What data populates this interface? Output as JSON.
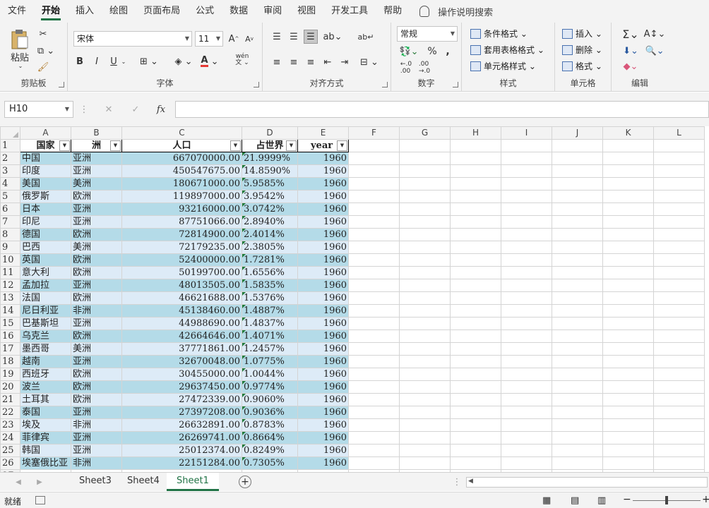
{
  "ribbon_tabs": [
    "文件",
    "开始",
    "插入",
    "绘图",
    "页面布局",
    "公式",
    "数据",
    "审阅",
    "视图",
    "开发工具",
    "帮助"
  ],
  "active_tab": "开始",
  "tell_me": "操作说明搜索",
  "clipboard": {
    "paste": "粘贴",
    "label": "剪贴板"
  },
  "font": {
    "name": "宋体",
    "size": "11",
    "label": "字体",
    "bold": "B",
    "italic": "I",
    "underline": "U",
    "font_color": "#e53935",
    "phonetic": "wén"
  },
  "alignment": {
    "label": "对齐方式"
  },
  "number": {
    "format": "常规",
    "label": "数字",
    "percent": "%",
    "comma": ","
  },
  "styles": {
    "conditional": "条件格式",
    "table": "套用表格格式",
    "cell": "单元格样式",
    "label": "样式"
  },
  "cells": {
    "insert": "插入",
    "delete": "删除",
    "format": "格式",
    "label": "单元格"
  },
  "editing": {
    "label": "编辑"
  },
  "formula_bar": {
    "name_box": "H10",
    "fx": "fx",
    "value": ""
  },
  "columns": [
    "A",
    "B",
    "C",
    "D",
    "E",
    "F",
    "G",
    "H",
    "I",
    "J",
    "K",
    "L"
  ],
  "header_row": {
    "num": "1",
    "cells": [
      "国家",
      "洲",
      "人口",
      "占世界",
      "year"
    ]
  },
  "rows": [
    {
      "num": "2",
      "c": [
        "中国",
        "亚洲",
        "667070000.00",
        "21.9999%",
        "1960"
      ]
    },
    {
      "num": "3",
      "c": [
        "印度",
        "亚洲",
        "450547675.00",
        "14.8590%",
        "1960"
      ]
    },
    {
      "num": "4",
      "c": [
        "美国",
        "美洲",
        "180671000.00",
        "5.9585%",
        "1960"
      ]
    },
    {
      "num": "5",
      "c": [
        "俄罗斯",
        "欧洲",
        "119897000.00",
        "3.9542%",
        "1960"
      ]
    },
    {
      "num": "6",
      "c": [
        "日本",
        "亚洲",
        "93216000.00",
        "3.0742%",
        "1960"
      ]
    },
    {
      "num": "7",
      "c": [
        "印尼",
        "亚洲",
        "87751066.00",
        "2.8940%",
        "1960"
      ]
    },
    {
      "num": "8",
      "c": [
        "德国",
        "欧洲",
        "72814900.00",
        "2.4014%",
        "1960"
      ]
    },
    {
      "num": "9",
      "c": [
        "巴西",
        "美洲",
        "72179235.00",
        "2.3805%",
        "1960"
      ]
    },
    {
      "num": "10",
      "c": [
        "英国",
        "欧洲",
        "52400000.00",
        "1.7281%",
        "1960"
      ]
    },
    {
      "num": "11",
      "c": [
        "意大利",
        "欧洲",
        "50199700.00",
        "1.6556%",
        "1960"
      ]
    },
    {
      "num": "12",
      "c": [
        "孟加拉",
        "亚洲",
        "48013505.00",
        "1.5835%",
        "1960"
      ]
    },
    {
      "num": "13",
      "c": [
        "法国",
        "欧洲",
        "46621688.00",
        "1.5376%",
        "1960"
      ]
    },
    {
      "num": "14",
      "c": [
        "尼日利亚",
        "非洲",
        "45138460.00",
        "1.4887%",
        "1960"
      ]
    },
    {
      "num": "15",
      "c": [
        "巴基斯坦",
        "亚洲",
        "44988690.00",
        "1.4837%",
        "1960"
      ]
    },
    {
      "num": "16",
      "c": [
        "乌克兰",
        "欧洲",
        "42664646.00",
        "1.4071%",
        "1960"
      ]
    },
    {
      "num": "17",
      "c": [
        "墨西哥",
        "美洲",
        "37771861.00",
        "1.2457%",
        "1960"
      ]
    },
    {
      "num": "18",
      "c": [
        "越南",
        "亚洲",
        "32670048.00",
        "1.0775%",
        "1960"
      ]
    },
    {
      "num": "19",
      "c": [
        "西班牙",
        "欧洲",
        "30455000.00",
        "1.0044%",
        "1960"
      ]
    },
    {
      "num": "20",
      "c": [
        "波兰",
        "欧洲",
        "29637450.00",
        "0.9774%",
        "1960"
      ]
    },
    {
      "num": "21",
      "c": [
        "土耳其",
        "欧洲",
        "27472339.00",
        "0.9060%",
        "1960"
      ]
    },
    {
      "num": "22",
      "c": [
        "泰国",
        "亚洲",
        "27397208.00",
        "0.9036%",
        "1960"
      ]
    },
    {
      "num": "23",
      "c": [
        "埃及",
        "非洲",
        "26632891.00",
        "0.8783%",
        "1960"
      ]
    },
    {
      "num": "24",
      "c": [
        "菲律宾",
        "亚洲",
        "26269741.00",
        "0.8664%",
        "1960"
      ]
    },
    {
      "num": "25",
      "c": [
        "韩国",
        "亚洲",
        "25012374.00",
        "0.8249%",
        "1960"
      ]
    },
    {
      "num": "26",
      "c": [
        "埃塞俄比亚",
        "非洲",
        "22151284.00",
        "0.7305%",
        "1960"
      ]
    },
    {
      "num": "27",
      "c": [
        "",
        "",
        "",
        "",
        ""
      ]
    }
  ],
  "sheets": [
    "Sheet3",
    "Sheet4",
    "Sheet1"
  ],
  "active_sheet": "Sheet1",
  "status": {
    "ready": "就绪"
  },
  "accent": "#217346"
}
